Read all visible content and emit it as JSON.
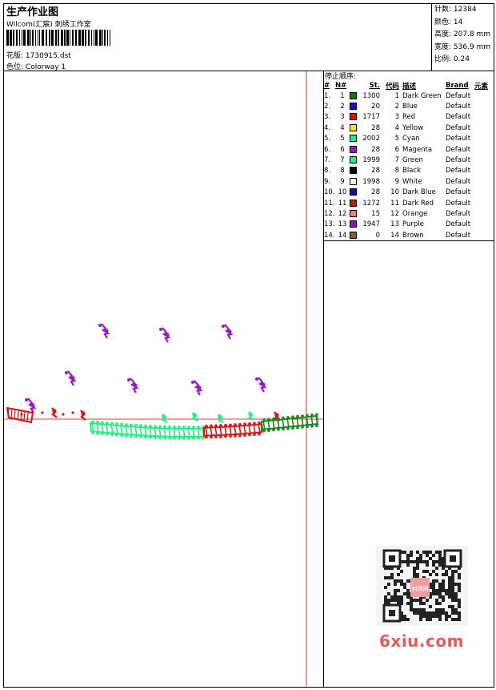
{
  "header": {
    "title": "生产作业图",
    "company": "Wilcom(汇宸) 刺绣工作室",
    "design_label": "花版:",
    "design_file": "1730915.dst",
    "colorway_label": "色位:",
    "colorway": "Colorway 1"
  },
  "stats": [
    {
      "label": "针数:",
      "value": "12384"
    },
    {
      "label": "颜色:",
      "value": "14"
    },
    {
      "label": "高度:",
      "value": "207.8 mm"
    },
    {
      "label": "宽度:",
      "value": "536.9 mm"
    },
    {
      "label": "比例:",
      "value": "0.24"
    }
  ],
  "stop_sequence": {
    "title": "停止顺序:",
    "headers": [
      "#",
      "N#",
      "St.",
      "代码",
      "描述",
      "Brand",
      "元素"
    ],
    "rows": [
      {
        "idx": "1.",
        "n": "1",
        "color": "#0a7a0a",
        "st": "1300",
        "code": "1",
        "desc": "Dark Green",
        "brand": "Default"
      },
      {
        "idx": "2.",
        "n": "2",
        "color": "#1010c8",
        "st": "20",
        "code": "2",
        "desc": "Blue",
        "brand": "Default"
      },
      {
        "idx": "3.",
        "n": "3",
        "color": "#e01010",
        "st": "1717",
        "code": "3",
        "desc": "Red",
        "brand": "Default"
      },
      {
        "idx": "4.",
        "n": "4",
        "color": "#f0f000",
        "st": "28",
        "code": "4",
        "desc": "Yellow",
        "brand": "Default"
      },
      {
        "idx": "5.",
        "n": "5",
        "color": "#20e890",
        "st": "2002",
        "code": "5",
        "desc": "Cyan",
        "brand": "Default"
      },
      {
        "idx": "6.",
        "n": "6",
        "color": "#a010c0",
        "st": "28",
        "code": "6",
        "desc": "Magenta",
        "brand": "Default"
      },
      {
        "idx": "7.",
        "n": "7",
        "color": "#20f080",
        "st": "1999",
        "code": "7",
        "desc": "Green",
        "brand": "Default"
      },
      {
        "idx": "8.",
        "n": "8",
        "color": "#000000",
        "st": "28",
        "code": "8",
        "desc": "Black",
        "brand": "Default"
      },
      {
        "idx": "9.",
        "n": "9",
        "color": "#f4f4f4",
        "st": "1998",
        "code": "9",
        "desc": "White",
        "brand": "Default"
      },
      {
        "idx": "10.",
        "n": "10",
        "color": "#1010b0",
        "st": "28",
        "code": "10",
        "desc": "Dark Blue",
        "brand": "Default"
      },
      {
        "idx": "11.",
        "n": "11",
        "color": "#d81010",
        "st": "1272",
        "code": "11",
        "desc": "Dark Red",
        "brand": "Default"
      },
      {
        "idx": "12.",
        "n": "12",
        "color": "#f08080",
        "st": "15",
        "code": "12",
        "desc": "Orange",
        "brand": "Default"
      },
      {
        "idx": "13.",
        "n": "13",
        "color": "#9010c0",
        "st": "1947",
        "code": "13",
        "desc": "Purple",
        "brand": "Default"
      },
      {
        "idx": "14.",
        "n": "14",
        "color": "#8a5a30",
        "st": "0",
        "code": "14",
        "desc": "Brown",
        "brand": "Default"
      }
    ]
  },
  "watermark": {
    "site": "6xiu.com",
    "qr_badge": "刺绣网"
  },
  "colors": {
    "purple": "#9a18c8",
    "green": "#20f080",
    "red": "#e01010",
    "dark_green": "#1a8a1a",
    "guide": "#cc0000"
  }
}
